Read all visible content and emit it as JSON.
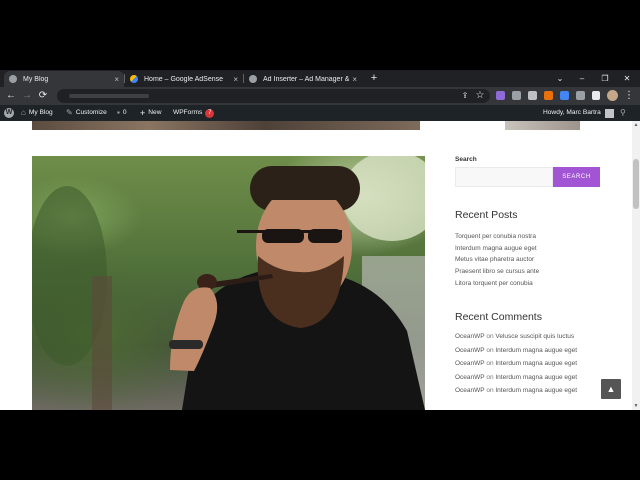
{
  "browser": {
    "tabs": [
      {
        "title": "My Blog",
        "active": true
      },
      {
        "title": "Home – Google AdSense",
        "active": false
      },
      {
        "title": "Ad Inserter – Ad Manager & Ad",
        "active": false
      }
    ],
    "new_tab_label": "+",
    "window_controls": {
      "dropdown": "⌄",
      "minimize": "–",
      "restore": "❐",
      "close": "✕"
    },
    "tab_close": "×",
    "nav": {
      "back": "←",
      "forward": "→",
      "reload": "⟳"
    },
    "toolbar_icons": {
      "share": "⇪",
      "star": "☆",
      "menu": "⋮"
    }
  },
  "admin_bar": {
    "site_name": "My Blog",
    "customize": "Customize",
    "comments_count": "0",
    "new_label": "New",
    "wpforms_label": "WPForms",
    "wpforms_count": "7",
    "greeting": "Howdy, Marc Bartra",
    "search_glyph": "⚲",
    "wp_glyph": "W",
    "home_glyph": "⌂",
    "brush_glyph": "✎",
    "comment_glyph": "▪",
    "plus_glyph": "+"
  },
  "sidebar": {
    "search_label": "Search",
    "search_button": "SEARCH",
    "recent_posts_title": "Recent Posts",
    "recent_posts": [
      "Torquent per conubia nostra",
      "Interdum magna augue eget",
      "Metus vitae pharetra auctor",
      "Praesent libro se cursus ante",
      "Litora torquent per conubia"
    ],
    "recent_comments_title": "Recent Comments",
    "recent_comments": [
      {
        "author": "OceanWP",
        "on": "on",
        "post": "Velusce suscipit quis luctus"
      },
      {
        "author": "OceanWP",
        "on": "on",
        "post": "Interdum magna augue eget"
      },
      {
        "author": "OceanWP",
        "on": "on",
        "post": "Interdum magna augue eget"
      },
      {
        "author": "OceanWP",
        "on": "on",
        "post": "Interdum magna augue eget"
      },
      {
        "author": "OceanWP",
        "on": "on",
        "post": "Interdum magna augue eget"
      }
    ]
  },
  "scroll_top_glyph": "▲",
  "colors": {
    "accent": "#a154d3",
    "admin_bar": "#1d2327",
    "tab_bg": "#202124",
    "toolbar_bg": "#35363a",
    "badge": "#d63638"
  }
}
